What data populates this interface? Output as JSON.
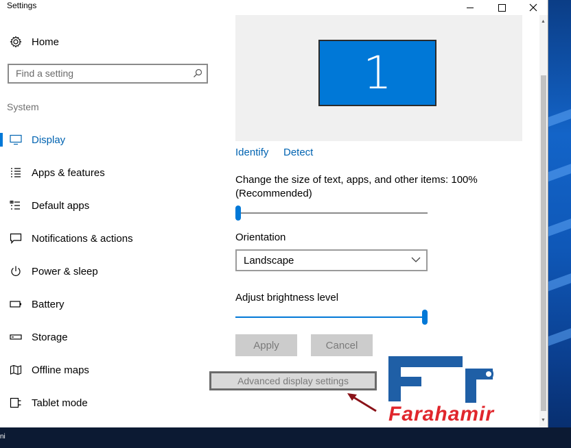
{
  "window": {
    "title": "Settings"
  },
  "nav": {
    "home_label": "Home",
    "search_placeholder": "Find a setting",
    "section_label": "System",
    "items": [
      {
        "label": "Display",
        "icon": "display-icon",
        "active": true
      },
      {
        "label": "Apps & features",
        "icon": "list-icon",
        "active": false
      },
      {
        "label": "Default apps",
        "icon": "default-apps-icon",
        "active": false
      },
      {
        "label": "Notifications & actions",
        "icon": "notification-icon",
        "active": false
      },
      {
        "label": "Power & sleep",
        "icon": "power-icon",
        "active": false
      },
      {
        "label": "Battery",
        "icon": "battery-icon",
        "active": false
      },
      {
        "label": "Storage",
        "icon": "storage-icon",
        "active": false
      },
      {
        "label": "Offline maps",
        "icon": "map-icon",
        "active": false
      },
      {
        "label": "Tablet mode",
        "icon": "tablet-icon",
        "active": false
      }
    ]
  },
  "display": {
    "monitor_number": "1",
    "identify_label": "Identify",
    "detect_label": "Detect",
    "scale_label_line1": "Change the size of text, apps, and other items: 100%",
    "scale_label_line2": "(Recommended)",
    "scale_value": 0,
    "orientation_label": "Orientation",
    "orientation_value": "Landscape",
    "brightness_label": "Adjust brightness level",
    "brightness_value": 1.0,
    "apply_label": "Apply",
    "cancel_label": "Cancel",
    "advanced_label": "Advanced display settings"
  },
  "taskbar": {
    "text": "ni"
  },
  "colors": {
    "accent": "#0078d7",
    "link": "#0063b1",
    "watermark_blue": "#1f5fa6",
    "watermark_red": "#e0262c"
  },
  "watermark": {
    "text": "Farahamir"
  }
}
